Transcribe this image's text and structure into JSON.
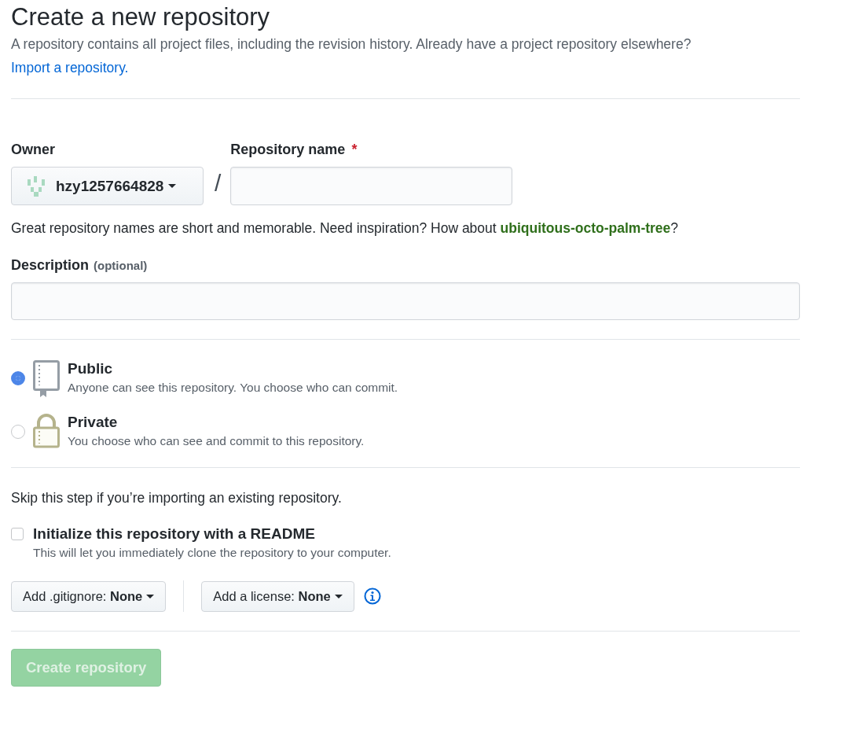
{
  "page": {
    "title": "Create a new repository",
    "intro": "A repository contains all project files, including the revision history. Already have a project repository elsewhere?",
    "import_link": "Import a repository."
  },
  "owner": {
    "label": "Owner",
    "value": "hzy1257664828"
  },
  "separator": "/",
  "repository_name": {
    "label": "Repository name",
    "required_mark": "*"
  },
  "name_hint": {
    "text": "Great repository names are short and memorable. Need inspiration? How about ",
    "suggestion": "ubiquitous-octo-palm-tree",
    "end": "?"
  },
  "description": {
    "label": "Description",
    "note": "(optional)"
  },
  "visibility": [
    {
      "kind": "public",
      "label": "Public",
      "text": "Anyone can see this repository. You choose who can commit.",
      "selected": true
    },
    {
      "kind": "private",
      "label": "Private",
      "text": "You choose who can see and commit to this repository.",
      "selected": false
    }
  ],
  "skip_note": "Skip this step if you’re importing an existing repository.",
  "init_readme": {
    "label": "Initialize this repository with a README",
    "text": "This will let you immediately clone the repository to your computer.",
    "checked": false
  },
  "dropdowns": [
    {
      "label": "Add .gitignore:",
      "value": "None"
    },
    {
      "label": "Add a license:",
      "value": "None"
    }
  ],
  "submit": {
    "label": "Create repository",
    "disabled": true
  }
}
